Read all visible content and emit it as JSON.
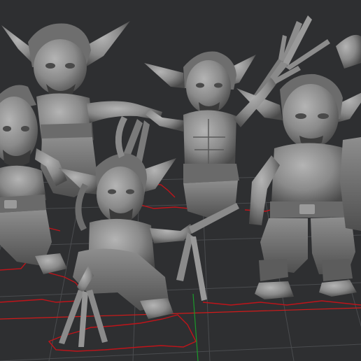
{
  "viewport": {
    "background_color": "#2e2f31",
    "grid_color": "#4a4c4f",
    "outline_color": "#c0141a",
    "model_color": "#8c8c8c",
    "model_shadow": "#4f4f4f",
    "model_highlight": "#bdbdbd"
  },
  "models": [
    {
      "name": "goblin-figure-left-back"
    },
    {
      "name": "goblin-figure-left-front"
    },
    {
      "name": "goblin-figure-center-crouching"
    },
    {
      "name": "goblin-figure-center-back"
    },
    {
      "name": "goblin-figure-right"
    },
    {
      "name": "goblin-figure-far-right-partial"
    }
  ],
  "icons": {
    "axis_x": "red-axis-line",
    "axis_y": "green-axis-line"
  }
}
